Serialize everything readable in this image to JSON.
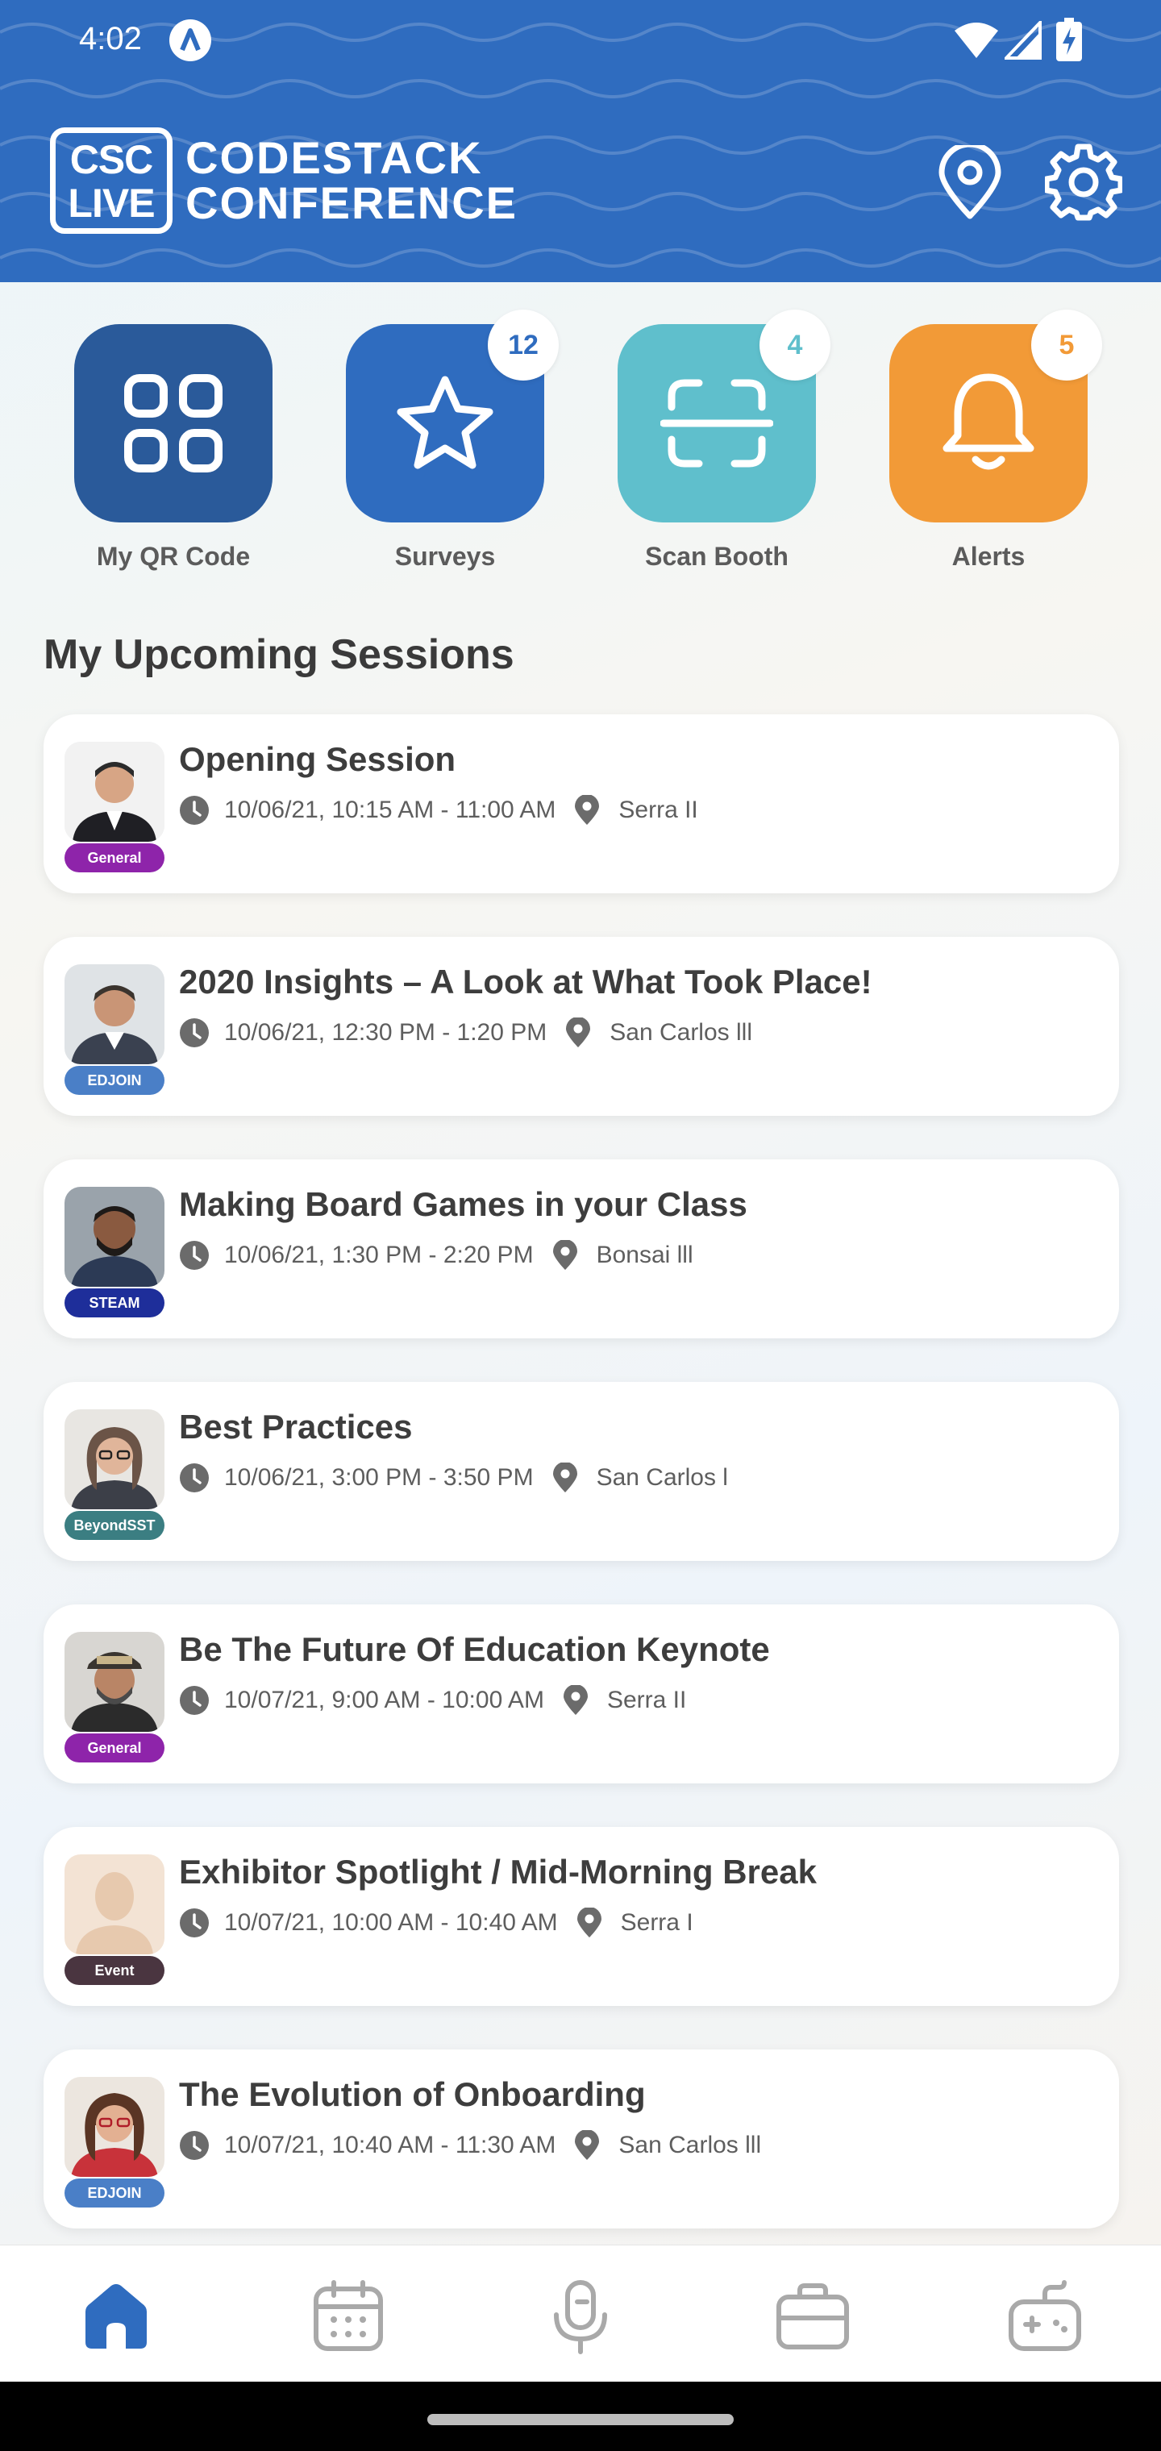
{
  "status_bar": {
    "time": "4:02"
  },
  "header": {
    "logo_badge_top": "CSC",
    "logo_badge_bottom": "LIVE",
    "logo_line1": "CODESTACK",
    "logo_line2": "CONFERENCE",
    "colors": {
      "background": "#2f6cbf"
    }
  },
  "quick_actions": [
    {
      "label": "My QR Code",
      "icon": "qr-grid-icon",
      "color": "#2a5a9a",
      "badge": ""
    },
    {
      "label": "Surveys",
      "icon": "star-icon",
      "color": "#2f6cbf",
      "badge": "12"
    },
    {
      "label": "Scan Booth",
      "icon": "scan-icon",
      "color": "#5fbfcc",
      "badge": "4"
    },
    {
      "label": "Alerts",
      "icon": "bell-icon",
      "color": "#f29a37",
      "badge": "5"
    }
  ],
  "section_title": "My Upcoming Sessions",
  "sessions": [
    {
      "title": "Opening Session",
      "time": "10/06/21, 10:15 AM - 11:00 AM",
      "room": "Serra II",
      "tag": "General",
      "tag_color": "#8e24aa"
    },
    {
      "title": "2020 Insights – A Look at What Took Place!",
      "time": "10/06/21, 12:30 PM - 1:20 PM",
      "room": "San Carlos lll",
      "tag": "EDJOIN",
      "tag_color": "#4a7fc7"
    },
    {
      "title": "Making Board Games in your Class",
      "time": "10/06/21, 1:30 PM - 2:20 PM",
      "room": "Bonsai lll",
      "tag": "STEAM",
      "tag_color": "#1e2e9a"
    },
    {
      "title": "Best Practices",
      "time": "10/06/21, 3:00 PM - 3:50 PM",
      "room": "San Carlos l",
      "tag": "BeyondSST",
      "tag_color": "#3b7e82"
    },
    {
      "title": "Be The Future Of Education Keynote",
      "time": "10/07/21, 9:00 AM - 10:00 AM",
      "room": "Serra II",
      "tag": "General",
      "tag_color": "#8e24aa"
    },
    {
      "title": "Exhibitor Spotlight / Mid-Morning Break",
      "time": "10/07/21, 10:00 AM - 10:40 AM",
      "room": "Serra I",
      "tag": "Event",
      "tag_color": "#4a3540"
    },
    {
      "title": "The Evolution of Onboarding",
      "time": "10/07/21, 10:40 AM - 11:30 AM",
      "room": "San Carlos lll",
      "tag": "EDJOIN",
      "tag_color": "#4a7fc7"
    }
  ],
  "bottom_nav": [
    {
      "icon": "home-icon",
      "active": true
    },
    {
      "icon": "calendar-icon",
      "active": false
    },
    {
      "icon": "microphone-icon",
      "active": false
    },
    {
      "icon": "briefcase-icon",
      "active": false
    },
    {
      "icon": "gamepad-icon",
      "active": false
    }
  ]
}
